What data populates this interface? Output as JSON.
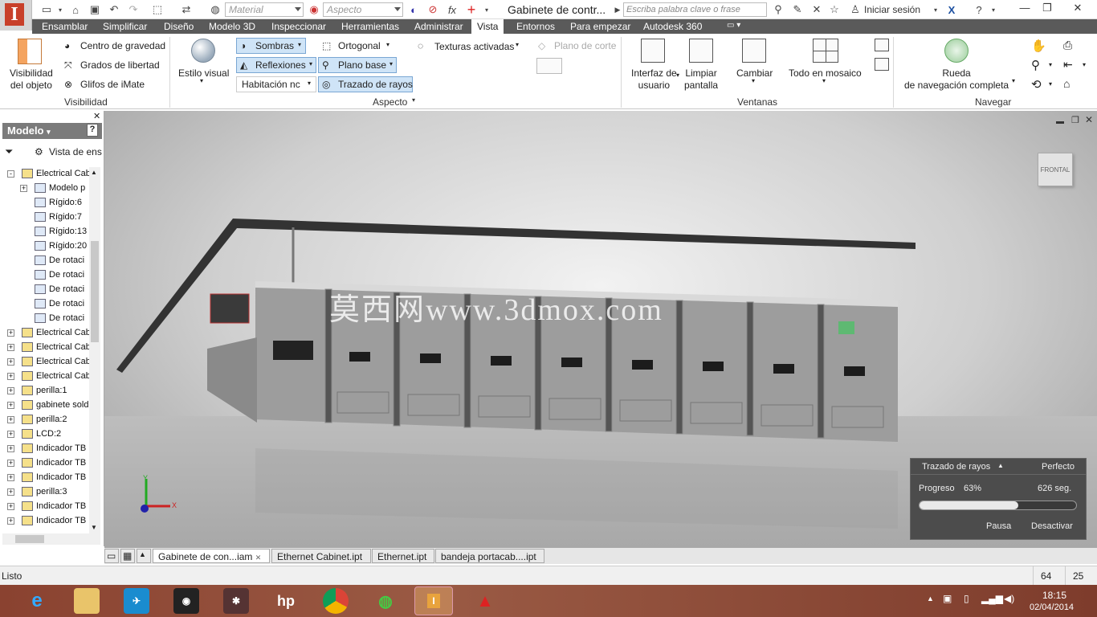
{
  "titlebar": {
    "document_title": "Gabinete de contr...",
    "material_placeholder": "Material",
    "appearance_placeholder": "Aspecto",
    "search_placeholder": "Escriba palabra clave o frase",
    "signin_label": "Iniciar sesión"
  },
  "menu": {
    "items": [
      "Ensamblar",
      "Simplificar",
      "Diseño",
      "Modelo 3D",
      "Inspeccionar",
      "Herramientas",
      "Administrar",
      "Vista",
      "Entornos",
      "Para empezar",
      "Autodesk 360"
    ],
    "active": "Vista"
  },
  "ribbon": {
    "visibility": {
      "big_label": "Visibilidad\ndel objeto",
      "items": [
        "Centro de gravedad",
        "Grados de libertad",
        "Glifos de iMate"
      ],
      "panel": "Visibilidad"
    },
    "aspecto": {
      "visual_style": "Estilo visual",
      "shadows": "Sombras",
      "reflections": "Reflexiones",
      "room": "Habitación nc",
      "orthographic": "Ortogonal",
      "ground_plane": "Plano base",
      "ray_tracing": "Trazado de rayos",
      "textures": "Texturas activadas",
      "section_plane": "Plano de corte",
      "panel": "Aspecto"
    },
    "ventanas": {
      "ui": "Interfaz de\nusuario",
      "clean": "Limpiar\npantalla",
      "switch": "Cambiar",
      "tile": "Todo en mosaico",
      "panel": "Ventanas"
    },
    "navegar": {
      "wheel": "Rueda\nde navegación completa",
      "panel": "Navegar"
    }
  },
  "browser": {
    "title": "Modelo",
    "view_label": "Vista de ens",
    "rows": [
      {
        "label": "Electrical Cab",
        "indent": 0,
        "exp": "-"
      },
      {
        "label": "Modelo p",
        "indent": 1,
        "exp": "+"
      },
      {
        "label": "Rígido:6",
        "indent": 1,
        "exp": ""
      },
      {
        "label": "Rígido:7",
        "indent": 1,
        "exp": ""
      },
      {
        "label": "Rígido:13",
        "indent": 1,
        "exp": ""
      },
      {
        "label": "Rígido:20",
        "indent": 1,
        "exp": ""
      },
      {
        "label": "De rotaci",
        "indent": 1,
        "exp": ""
      },
      {
        "label": "De rotaci",
        "indent": 1,
        "exp": ""
      },
      {
        "label": "De rotaci",
        "indent": 1,
        "exp": ""
      },
      {
        "label": "De rotaci",
        "indent": 1,
        "exp": ""
      },
      {
        "label": "De rotaci",
        "indent": 1,
        "exp": ""
      },
      {
        "label": "Electrical Cab",
        "indent": 0,
        "exp": "+"
      },
      {
        "label": "Electrical Cab",
        "indent": 0,
        "exp": "+"
      },
      {
        "label": "Electrical Cab",
        "indent": 0,
        "exp": "+"
      },
      {
        "label": "Electrical Cab",
        "indent": 0,
        "exp": "+"
      },
      {
        "label": "perilla:1",
        "indent": 0,
        "exp": "+"
      },
      {
        "label": "gabinete sold",
        "indent": 0,
        "exp": "+"
      },
      {
        "label": "perilla:2",
        "indent": 0,
        "exp": "+"
      },
      {
        "label": "LCD:2",
        "indent": 0,
        "exp": "+"
      },
      {
        "label": "Indicador TB",
        "indent": 0,
        "exp": "+"
      },
      {
        "label": "Indicador TB",
        "indent": 0,
        "exp": "+"
      },
      {
        "label": "Indicador TB",
        "indent": 0,
        "exp": "+"
      },
      {
        "label": "perilla:3",
        "indent": 0,
        "exp": "+"
      },
      {
        "label": "Indicador TB",
        "indent": 0,
        "exp": "+"
      },
      {
        "label": "Indicador TB",
        "indent": 0,
        "exp": "+"
      }
    ]
  },
  "viewport": {
    "viewcube_label": "FRONTAL",
    "watermark": "莫西网www.3dmox.com",
    "axes": {
      "x": "X",
      "y": "Y"
    }
  },
  "raytrace": {
    "title": "Trazado de rayos",
    "quality": "Perfecto",
    "progress_label": "Progreso",
    "progress_value": "63%",
    "progress_fraction": 0.63,
    "time": "626 seg.",
    "pause": "Pausa",
    "deactivate": "Desactivar"
  },
  "doc_tabs": [
    "Gabinete de con...iam",
    "Ethernet Cabinet.ipt",
    "Ethernet.ipt",
    "bandeja portacab....ipt"
  ],
  "status": {
    "text": "Listo",
    "count1": "64",
    "count2": "25"
  },
  "taskbar": {
    "time": "18:15",
    "date": "02/04/2014"
  }
}
